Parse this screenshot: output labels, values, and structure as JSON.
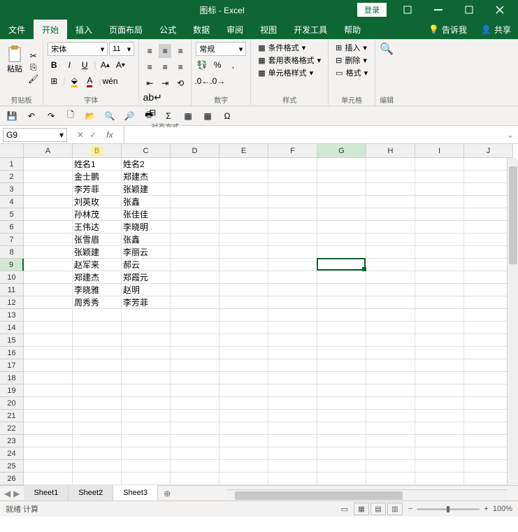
{
  "titlebar": {
    "title": "图标 - Excel",
    "login": "登录"
  },
  "menu": {
    "file": "文件",
    "home": "开始",
    "insert": "插入",
    "layout": "页面布局",
    "formulas": "公式",
    "data": "数据",
    "review": "审阅",
    "view": "视图",
    "dev": "开发工具",
    "help": "帮助",
    "tellme": "告诉我",
    "share": "共享"
  },
  "ribbon": {
    "clipboard": {
      "paste": "粘贴",
      "title": "剪贴板"
    },
    "font": {
      "name": "宋体",
      "size": "11",
      "title": "字体"
    },
    "align": {
      "title": "对齐方式"
    },
    "number": {
      "format": "常规",
      "title": "数字"
    },
    "styles": {
      "cond": "条件格式",
      "table": "套用表格格式",
      "cell": "单元格样式",
      "title": "样式"
    },
    "cells": {
      "insert": "插入",
      "delete": "删除",
      "format": "格式",
      "title": "单元格"
    },
    "editing": {
      "title": "编辑"
    }
  },
  "formula": {
    "name_box": "G9"
  },
  "columns": [
    "A",
    "B",
    "C",
    "D",
    "E",
    "F",
    "G",
    "H",
    "I",
    "J"
  ],
  "rows_count": 26,
  "selected_row": 9,
  "selected_col": 6,
  "active_cell": {
    "col": 6,
    "row": 9
  },
  "data_b": [
    "姓名1",
    "金士鹏",
    "李芳菲",
    "刘英玫",
    "孙林茂",
    "王伟达",
    "张雪眉",
    "张颖建",
    "赵军来",
    "郑建杰",
    "李晓雅",
    "周秀秀"
  ],
  "data_c": [
    "姓名2",
    "郑建杰",
    "张颖建",
    "张鑫",
    "张佳佳",
    "李晓明",
    "张鑫",
    "李丽云",
    "郝云",
    "郑霞元",
    "赵明",
    "李芳菲"
  ],
  "sheets": {
    "s1": "Sheet1",
    "s2": "Sheet2",
    "s3": "Sheet3",
    "active": 2
  },
  "status": {
    "left": "就绪  计算",
    "zoom": "100%"
  }
}
